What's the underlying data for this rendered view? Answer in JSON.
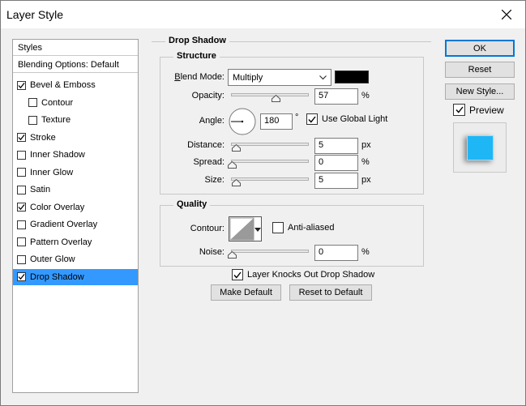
{
  "window": {
    "title": "Layer Style"
  },
  "sidebar": {
    "header_styles": "Styles",
    "header_blending": "Blending Options: Default",
    "items": [
      {
        "label": "Bevel & Emboss",
        "checked": true
      },
      {
        "label": "Contour",
        "checked": false,
        "indent": true
      },
      {
        "label": "Texture",
        "checked": false,
        "indent": true
      },
      {
        "label": "Stroke",
        "checked": true
      },
      {
        "label": "Inner Shadow",
        "checked": false
      },
      {
        "label": "Inner Glow",
        "checked": false
      },
      {
        "label": "Satin",
        "checked": false
      },
      {
        "label": "Color Overlay",
        "checked": true
      },
      {
        "label": "Gradient Overlay",
        "checked": false
      },
      {
        "label": "Pattern Overlay",
        "checked": false
      },
      {
        "label": "Outer Glow",
        "checked": false
      },
      {
        "label": "Drop Shadow",
        "checked": true,
        "selected": true
      }
    ]
  },
  "drop_shadow": {
    "section_title": "Drop Shadow",
    "structure": {
      "title": "Structure",
      "blend_mode_label": "Blend Mode:",
      "blend_mode_value": "Multiply",
      "blend_color": "#000000",
      "opacity_label": "Opacity:",
      "opacity_value": "57",
      "opacity_unit": "%",
      "opacity_fraction": 0.57,
      "angle_label": "Angle:",
      "angle_value": "180",
      "angle_unit": "°",
      "use_global_light_label": "Use Global Light",
      "use_global_light_checked": true,
      "distance_label": "Distance:",
      "distance_value": "5",
      "distance_unit": "px",
      "spread_label": "Spread:",
      "spread_value": "0",
      "spread_unit": "%",
      "size_label": "Size:",
      "size_value": "5",
      "size_unit": "px"
    },
    "quality": {
      "title": "Quality",
      "contour_label": "Contour:",
      "anti_aliased_label": "Anti-aliased",
      "anti_aliased_checked": false,
      "noise_label": "Noise:",
      "noise_value": "0",
      "noise_unit": "%"
    },
    "knocks_out_label": "Layer Knocks Out Drop Shadow",
    "knocks_out_checked": true,
    "make_default_label": "Make Default",
    "reset_default_label": "Reset to Default"
  },
  "actions": {
    "ok_label": "OK",
    "reset_label": "Reset",
    "new_style_label": "New Style...",
    "preview_label": "Preview",
    "preview_checked": true
  },
  "colors": {
    "selection": "#3399ff",
    "preview_swatch": "#1fb6f5",
    "accent_border": "#0078d7"
  }
}
